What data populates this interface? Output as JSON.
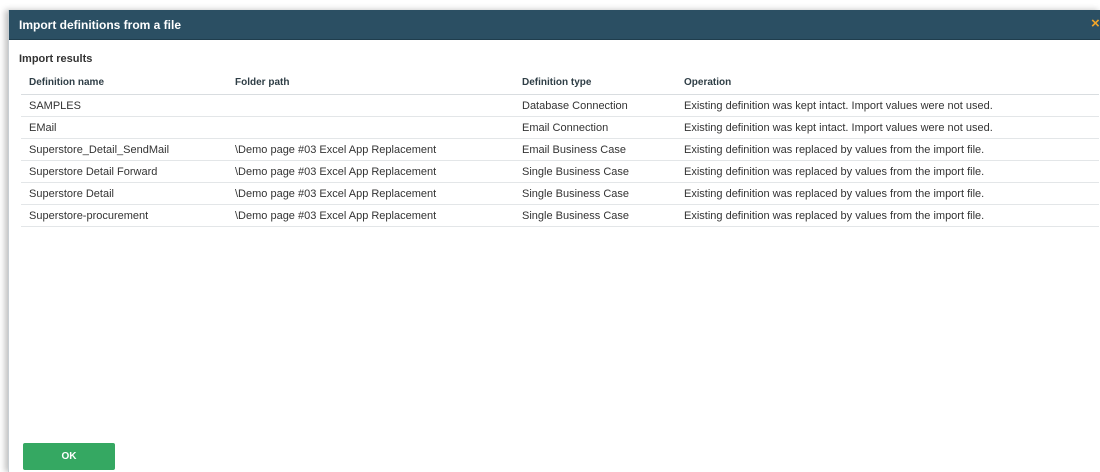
{
  "dialog": {
    "title": "Import definitions from a file",
    "close_icon": "close-icon",
    "close_symbol": "×",
    "colors": {
      "titlebar": "#2b4f63",
      "close": "#f0a52a",
      "ok_button": "#35a862"
    }
  },
  "results": {
    "title": "Import results",
    "columns": [
      "Definition name",
      "Folder path",
      "Definition type",
      "Operation"
    ],
    "rows": [
      [
        "SAMPLES",
        "",
        "Database Connection",
        "Existing definition was kept intact. Import values were not used."
      ],
      [
        "EMail",
        "",
        "Email Connection",
        "Existing definition was kept intact. Import values were not used."
      ],
      [
        "Superstore_Detail_SendMail",
        "\\Demo page #03 Excel App Replacement",
        "Email Business Case",
        "Existing definition was replaced by values from the import file."
      ],
      [
        "Superstore Detail Forward",
        "\\Demo page #03 Excel App Replacement",
        "Single Business Case",
        "Existing definition was replaced by values from the import file."
      ],
      [
        "Superstore Detail",
        "\\Demo page #03 Excel App Replacement",
        "Single Business Case",
        "Existing definition was replaced by values from the import file."
      ],
      [
        "Superstore-procurement",
        "\\Demo page #03 Excel App Replacement",
        "Single Business Case",
        "Existing definition was replaced by values from the import file."
      ]
    ]
  },
  "footer": {
    "ok_label": "OK"
  }
}
